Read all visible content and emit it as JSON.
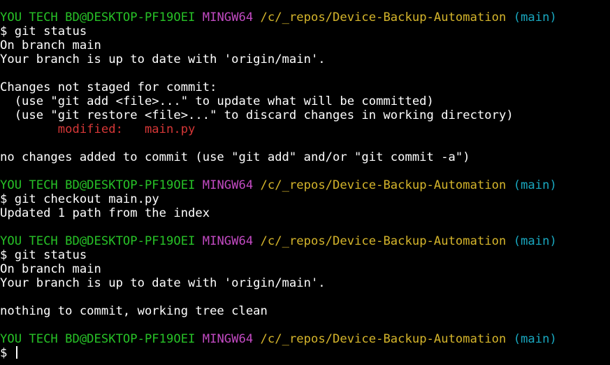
{
  "prompt": {
    "user_host": "YOU TECH BD@DESKTOP-PF19OEI",
    "system": "MINGW64",
    "path": "/c/_repos/Device-Backup-Automation",
    "branch": "(main)",
    "symbol": "$"
  },
  "blocks": [
    {
      "command": "git status",
      "output": [
        {
          "text": "On branch main"
        },
        {
          "text": "Your branch is up to date with 'origin/main'."
        },
        {
          "text": ""
        },
        {
          "text": "Changes not staged for commit:"
        },
        {
          "text": "  (use \"git add <file>...\" to update what will be committed)"
        },
        {
          "text": "  (use \"git restore <file>...\" to discard changes in working directory)"
        },
        {
          "text": "        modified:   main.py",
          "color": "red"
        },
        {
          "text": ""
        },
        {
          "text": "no changes added to commit (use \"git add\" and/or \"git commit -a\")"
        },
        {
          "text": ""
        }
      ]
    },
    {
      "command": "git checkout main.py",
      "output": [
        {
          "text": "Updated 1 path from the index"
        },
        {
          "text": ""
        }
      ]
    },
    {
      "command": "git status",
      "output": [
        {
          "text": "On branch main"
        },
        {
          "text": "Your branch is up to date with 'origin/main'."
        },
        {
          "text": ""
        },
        {
          "text": "nothing to commit, working tree clean"
        },
        {
          "text": ""
        }
      ]
    }
  ],
  "current_input": "",
  "colors": {
    "background": "#000000",
    "user_host": "#27c227",
    "system": "#c24ac2",
    "path": "#d5b52b",
    "branch": "#19a8c0",
    "modified": "#d63737",
    "text": "#ffffff"
  }
}
